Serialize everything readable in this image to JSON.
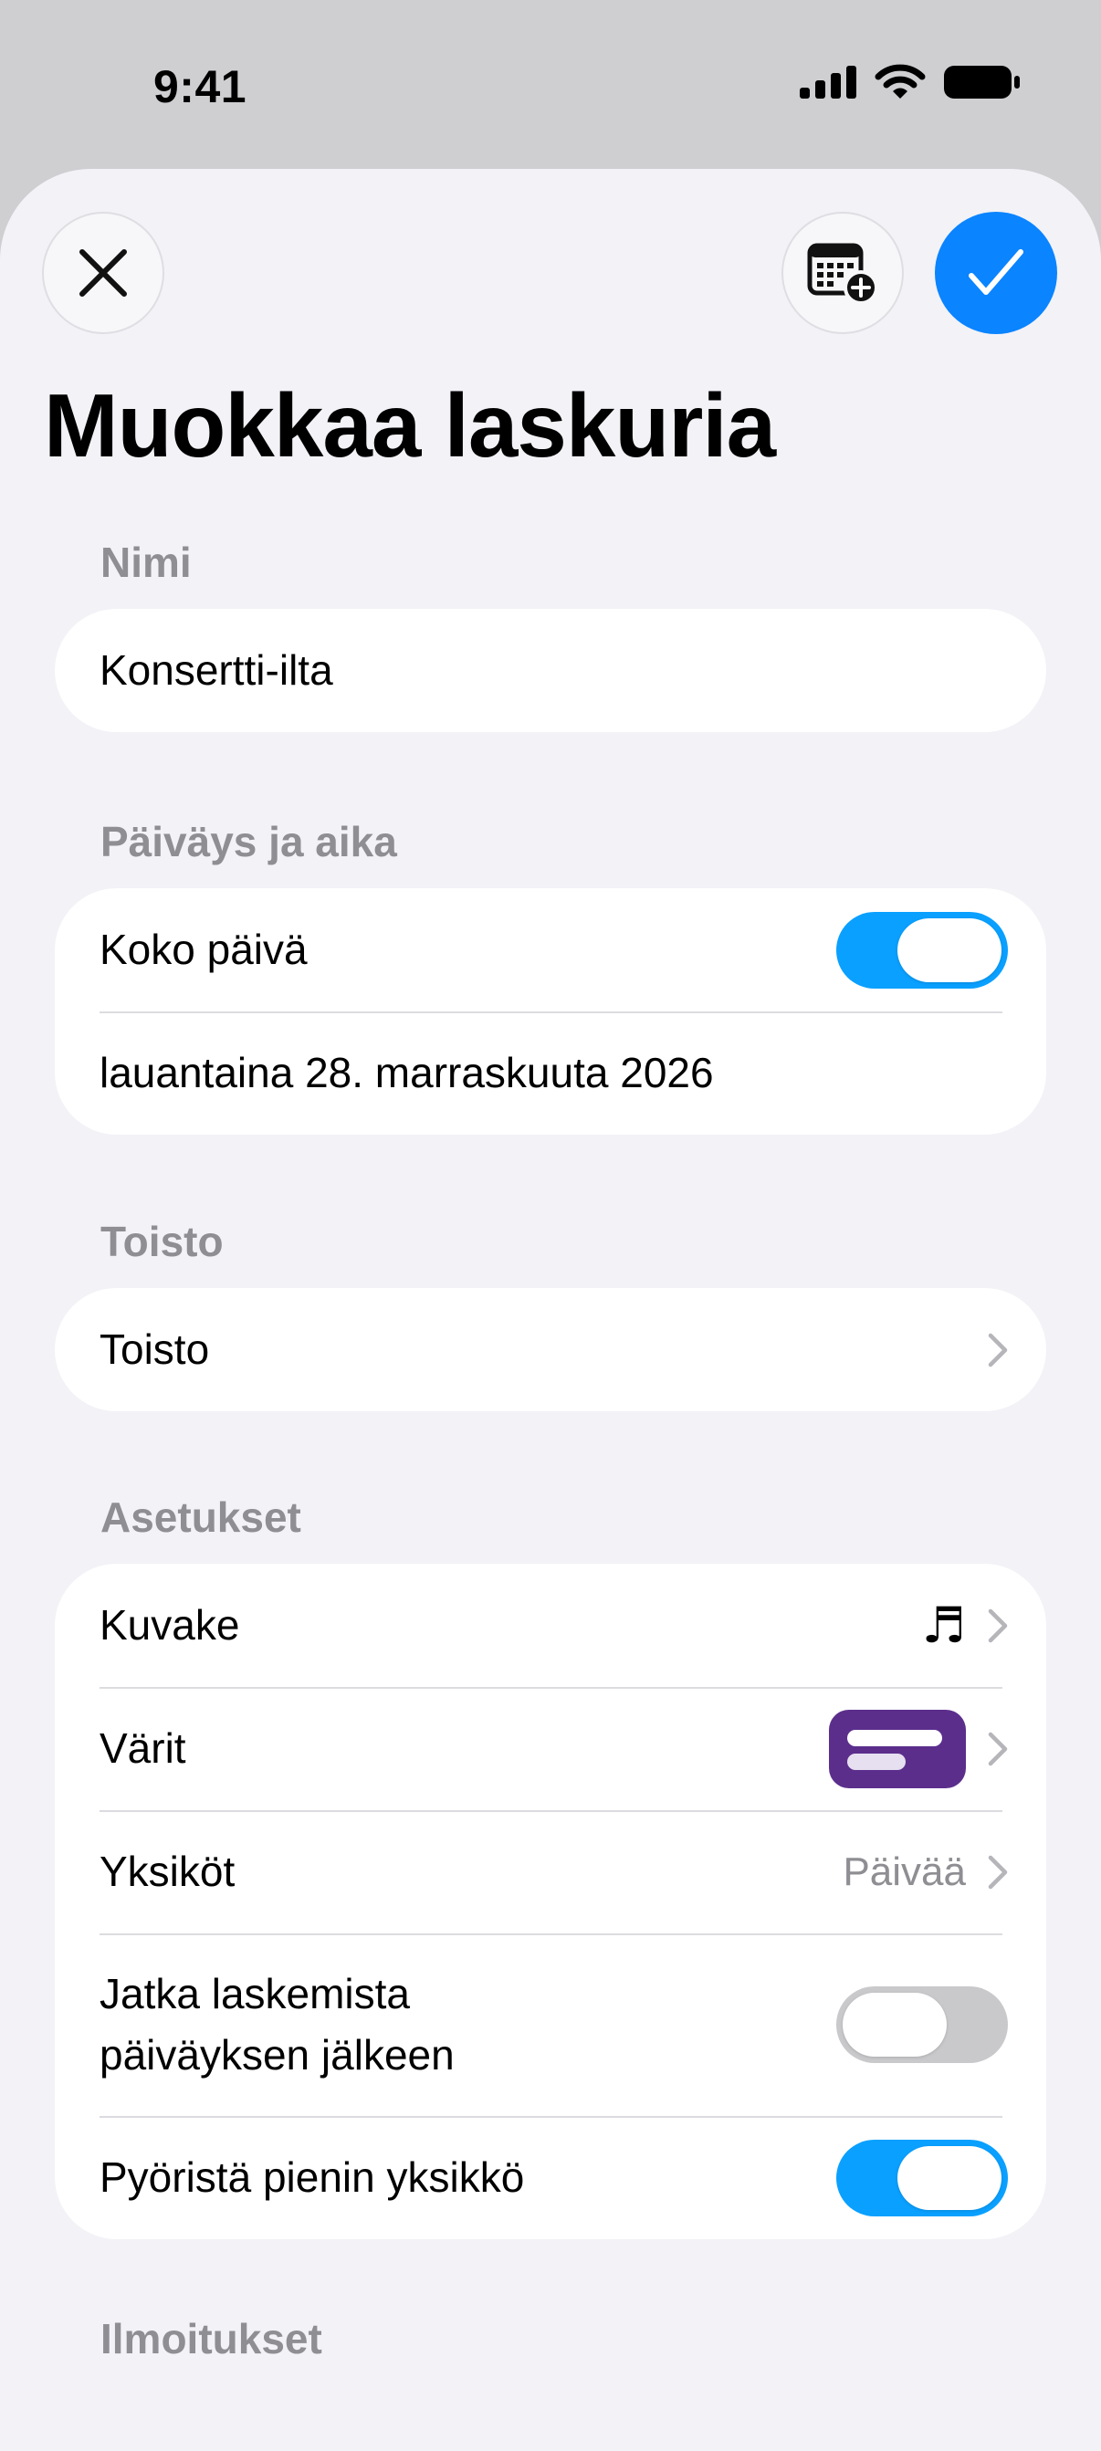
{
  "status_bar": {
    "time": "9:41"
  },
  "header": {
    "title": "Muokkaa laskuria"
  },
  "sections": {
    "name": {
      "label": "Nimi",
      "value": "Konsertti-ilta"
    },
    "datetime": {
      "label": "Päiväys ja aika",
      "all_day_label": "Koko päivä",
      "all_day_on": true,
      "date_text": "lauantaina 28. marraskuuta 2026"
    },
    "repeat": {
      "label": "Toisto",
      "row_label": "Toisto"
    },
    "settings": {
      "label": "Asetukset",
      "icon_label": "Kuvake",
      "icon_glyph": "♬",
      "colors_label": "Värit",
      "colors_swatch": "#5b2e8c",
      "units_label": "Yksiköt",
      "units_value": "Päivää",
      "continue_label_line1": "Jatka laskemista",
      "continue_label_line2": "päiväyksen jälkeen",
      "continue_on": false,
      "round_label": "Pyöristä pienin yksikkö",
      "round_on": true
    },
    "notifications": {
      "label": "Ilmoitukset"
    }
  },
  "colors": {
    "accent": "#0a84ff",
    "toggle_on": "#0aa0ff",
    "toggle_off": "#c9c9cc",
    "secondary_text": "#8e8e93",
    "background": "#f2f2f7"
  }
}
